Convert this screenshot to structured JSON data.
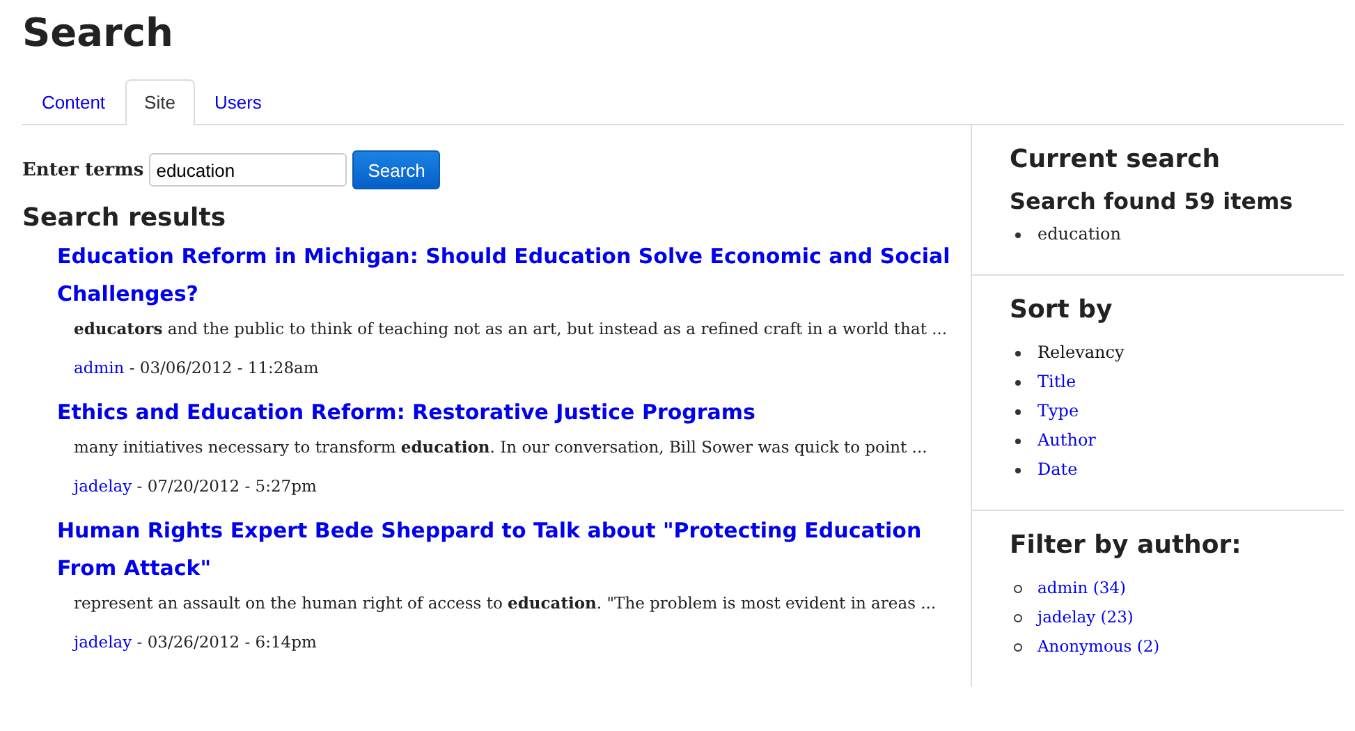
{
  "page_title": "Search",
  "tabs": [
    {
      "label": "Content",
      "selected": false
    },
    {
      "label": "Site",
      "selected": true
    },
    {
      "label": "Users",
      "selected": false
    }
  ],
  "search_form": {
    "label": "Enter terms",
    "value": "education",
    "button": "Search"
  },
  "results_heading": "Search results",
  "results": [
    {
      "title": "Education Reform in Michigan: Should Education Solve Economic and Social Challenges?",
      "snippet": "**educators** and the public to think of teaching not as an art, but instead as a refined craft in a world that ...",
      "author": "admin",
      "date": "- 03/06/2012 - 11:28am"
    },
    {
      "title": "Ethics and Education Reform: Restorative Justice Programs",
      "snippet": "many initiatives necessary to transform **education**. In our conversation, Bill Sower was quick to point ...",
      "author": "jadelay",
      "date": "- 07/20/2012 - 5:27pm"
    },
    {
      "title": "Human Rights Expert Bede Sheppard to Talk about \"Protecting Education From Attack\"",
      "snippet": "represent an assault on the human right of access to **education**. \"The problem is most evident in areas ...",
      "author": "jadelay",
      "date": "- 03/26/2012 - 6:14pm"
    }
  ],
  "sidebar": {
    "current_search": {
      "heading": "Current search",
      "subheading": "Search found 59 items",
      "terms": [
        "education"
      ]
    },
    "sort_by": {
      "heading": "Sort by",
      "items": [
        {
          "label": "Relevancy",
          "selected": true
        },
        {
          "label": "Title",
          "selected": false
        },
        {
          "label": "Type",
          "selected": false
        },
        {
          "label": "Author",
          "selected": false
        },
        {
          "label": "Date",
          "selected": false
        }
      ]
    },
    "filter_by_author": {
      "heading": "Filter by author:",
      "items": [
        "admin (34)",
        "jadelay (23)",
        "Anonymous (2)"
      ]
    }
  }
}
